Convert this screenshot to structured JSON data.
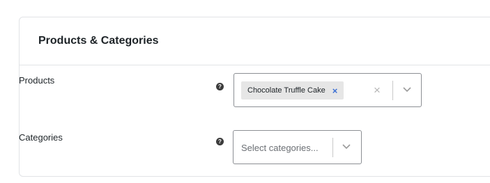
{
  "section": {
    "title": "Products & Categories"
  },
  "products": {
    "label": "Products",
    "help_icon": "question-circle-icon",
    "selected": [
      "Chocolate Truffle Cake"
    ],
    "tag_remove_glyph": "×",
    "clear_glyph": "×"
  },
  "categories": {
    "label": "Categories",
    "help_icon": "question-circle-icon",
    "placeholder": "Select categories..."
  },
  "help_glyph": "?",
  "colors": {
    "annotation_arrow": "#e8201a",
    "tag_remove": "#3b6fd4",
    "border": "#8c8f94"
  }
}
